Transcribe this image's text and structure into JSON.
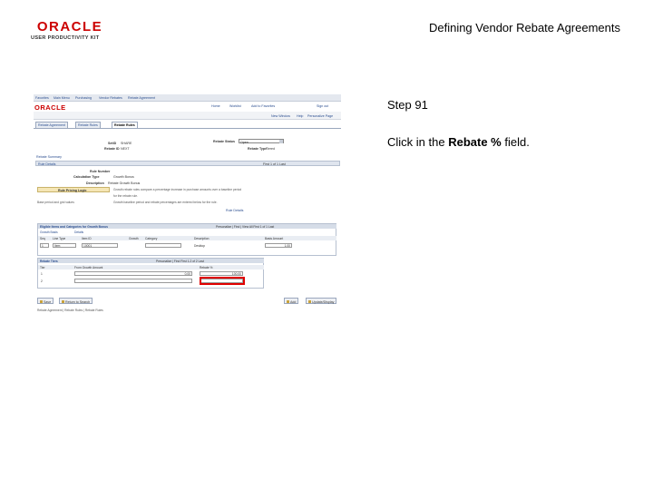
{
  "header": {
    "logo_word": "ORACLE",
    "logo_sub": "USER PRODUCTIVITY KIT",
    "title": "Defining Vendor Rebate Agreements"
  },
  "step": {
    "label": "Step 91",
    "prefix": "Click in the ",
    "field": "Rebate %",
    "suffix": " field."
  },
  "screen": {
    "breadcrumb": [
      "Favorites",
      "Main Menu",
      "Purchasing",
      "Vendor Rebates",
      "Rebate Agreement"
    ],
    "app_logo": "ORACLE",
    "top_links": [
      "Home",
      "Worklist",
      "Add to Favorites",
      "Sign out"
    ],
    "right_links": [
      "New Window",
      "Help",
      "Personalize Page"
    ],
    "tabs": [
      "Rebate Agreement",
      "Rebate Rules",
      "Rebate Rules"
    ],
    "setid_label": "SetID",
    "setid_value": "SHARE",
    "rebate_id_label": "Rebate ID",
    "rebate_id_value": "NEXT",
    "status_label": "Rebate Status",
    "status_value": "Open",
    "rebate_type_label": "Rebate Type",
    "rebate_type_value": "Tiered",
    "summary_link": "Rebate Summary",
    "rule_details_label": "Rule Details",
    "rule_nav": "First  1 of 1  Last",
    "rule_number_label": "Rule Number",
    "rule_type_label": "Calculation Type",
    "rule_type_value": "Growth Bonus",
    "description_label": "Description",
    "description_value": "Rebate Growth Bonus",
    "growth_button": "Rule Pricing Logic",
    "para_lines": [
      "Growth rebate rules compare a percentage increase in purchase amounts over a baseline period",
      "for the rebate rule.",
      "Growth baseline period and rebate percentages are entered below for the rule."
    ],
    "side_note": "Base period and grid values",
    "link_mid": "Rule Details",
    "grid1_title": "Eligible Items and Categories for Growth Bonus",
    "grid1_nav": "Personalize | Find | View All   First  1 of 1  Last",
    "grid1_tabs": [
      "Growth Basis",
      "Details"
    ],
    "grid1_headers": [
      "Seq",
      "Line Type",
      "Item ID",
      "Growth",
      "Category",
      "Description",
      "Basis Amount"
    ],
    "grid1_row": [
      "1",
      "Item",
      "10001",
      "",
      "",
      "Desktop",
      "1.00"
    ],
    "grid2_title": "Rebate Tiers",
    "grid2_nav": "Personalize | Find   First  1-2 of 2  Last",
    "grid2_headers": [
      "Tier",
      "From Growth Amount",
      "Rebate %"
    ],
    "grid2_rows": [
      [
        "1",
        "0.00",
        "100.00"
      ],
      [
        "2",
        "",
        ""
      ]
    ],
    "buttons_left": [
      "Save",
      "Return to Search"
    ],
    "buttons_right": [
      "Add",
      "Update/Display"
    ],
    "footer": "Rebate Agreement | Rebate Rules | Rebate Rules"
  }
}
